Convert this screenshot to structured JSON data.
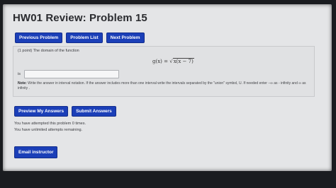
{
  "page": {
    "title": "HW01 Review: Problem 15"
  },
  "nav": {
    "previous_label": "Previous Problem",
    "list_label": "Problem List",
    "next_label": "Next Problem"
  },
  "problem": {
    "intro": "(1 point) The domain of the function",
    "formula_lhs": "g(x) = ",
    "radical_symbol": "√",
    "formula_radicand": "x(x − 7)",
    "is_label": "is",
    "answer_value": "",
    "note_label": "Note:",
    "note_text": "Write the answer in interval notation. If the answer includes more than one interval write the intervals separated by the \"union\" symbol, U. If needed enter −∞ as - infinity and ∞ as infinity ."
  },
  "actions": {
    "preview_label": "Preview My Answers",
    "submit_label": "Submit Answers"
  },
  "status": {
    "attempts": "You have attempted this problem 0 times.",
    "remaining": "You have unlimited attempts remaining."
  },
  "footer": {
    "email_label": "Email instructor"
  },
  "colors": {
    "button_blue": "#1b3fb8",
    "page_background": "#e4e5e7"
  }
}
